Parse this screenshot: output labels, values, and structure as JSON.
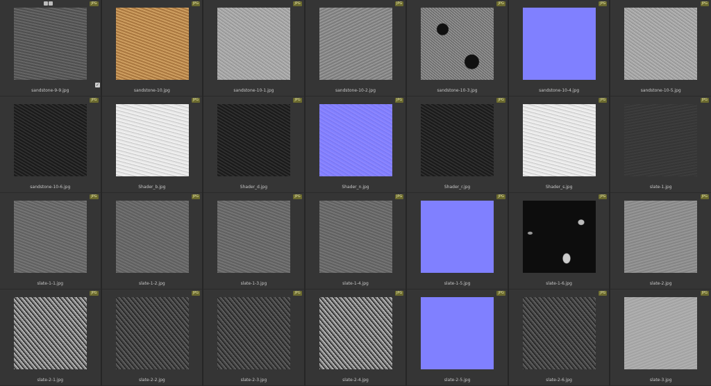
{
  "badge": "JPG",
  "selected_check": "✓",
  "tiles": [
    {
      "name": "sandstone-9-9.jpg",
      "texture": "tex-gray"
    },
    {
      "name": "sandstone-10.jpg",
      "texture": "tex-sand"
    },
    {
      "name": "sandstone-10-1.jpg",
      "texture": "tex-light"
    },
    {
      "name": "sandstone-10-2.jpg",
      "texture": "tex-mid"
    },
    {
      "name": "sandstone-10-3.jpg",
      "texture": "tex-spot"
    },
    {
      "name": "sandstone-10-4.jpg",
      "texture": "tex-normal"
    },
    {
      "name": "sandstone-10-5.jpg",
      "texture": "tex-light"
    },
    {
      "name": "sandstone-10-6.jpg",
      "texture": "tex-dark"
    },
    {
      "name": "Shader_b.jpg",
      "texture": "tex-white"
    },
    {
      "name": "Shader_d.jpg",
      "texture": "tex-dark"
    },
    {
      "name": "Shader_n.jpg",
      "texture": "tex-normal2"
    },
    {
      "name": "Shader_r.jpg",
      "texture": "tex-dark"
    },
    {
      "name": "Shader_s.jpg",
      "texture": "tex-white"
    },
    {
      "name": "slate-1.jpg",
      "texture": "tex-slate"
    },
    {
      "name": "slate-1-1.jpg",
      "texture": "tex-slate1"
    },
    {
      "name": "slate-1-2.jpg",
      "texture": "tex-slate2"
    },
    {
      "name": "slate-1-3.jpg",
      "texture": "tex-slate1"
    },
    {
      "name": "slate-1-4.jpg",
      "texture": "tex-slate1"
    },
    {
      "name": "slate-1-5.jpg",
      "texture": "tex-normal"
    },
    {
      "name": "slate-1-6.jpg",
      "texture": "tex-black"
    },
    {
      "name": "slate-2.jpg",
      "texture": "tex-silver"
    },
    {
      "name": "slate-2-1.jpg",
      "texture": "tex-rock"
    },
    {
      "name": "slate-2-2.jpg",
      "texture": "tex-rockdk"
    },
    {
      "name": "slate-2-3.jpg",
      "texture": "tex-rockdk"
    },
    {
      "name": "slate-2-4.jpg",
      "texture": "tex-rock"
    },
    {
      "name": "slate-2-5.jpg",
      "texture": "tex-normal"
    },
    {
      "name": "slate-2-6.jpg",
      "texture": "tex-rockdk"
    },
    {
      "name": "slate-3.jpg",
      "texture": "tex-pale"
    }
  ]
}
